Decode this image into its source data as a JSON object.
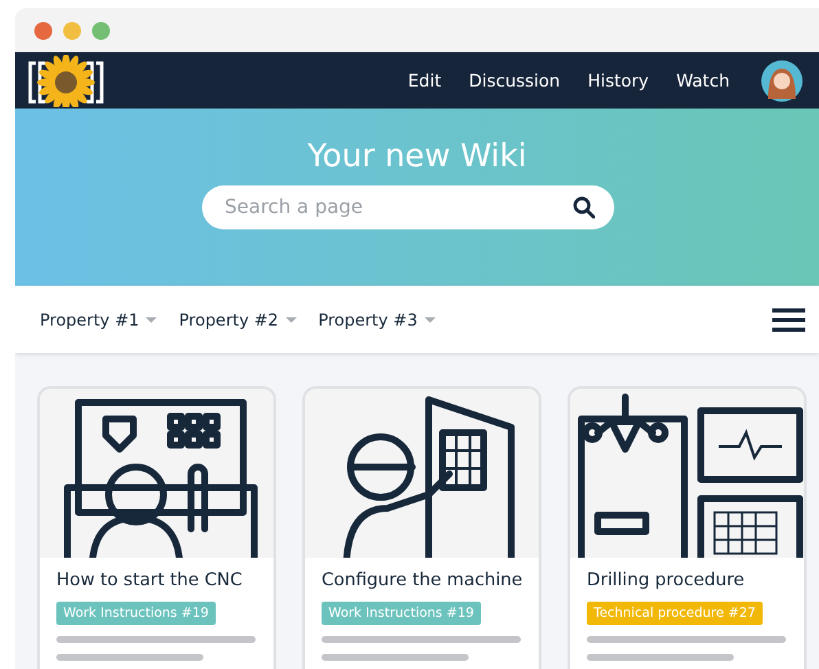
{
  "nav": {
    "links": [
      "Edit",
      "Discussion",
      "History",
      "Watch"
    ]
  },
  "hero": {
    "title": "Your new Wiki",
    "search": {
      "placeholder": "Search a page"
    }
  },
  "filters": [
    "Property #1",
    "Property #2",
    "Property #3"
  ],
  "cards": [
    {
      "kind": "operator",
      "title": "How to start the CNC",
      "tag": {
        "label": "Work Instructions #19",
        "color": "#6cc3bd"
      }
    },
    {
      "kind": "panel",
      "title": "Configure the machine",
      "tag": {
        "label": "Work Instructions #19",
        "color": "#6cc3bd"
      }
    },
    {
      "kind": "drill",
      "title": "Drilling procedure",
      "tag": {
        "label": "Technical procedure #27",
        "color": "#f2b807"
      }
    }
  ]
}
